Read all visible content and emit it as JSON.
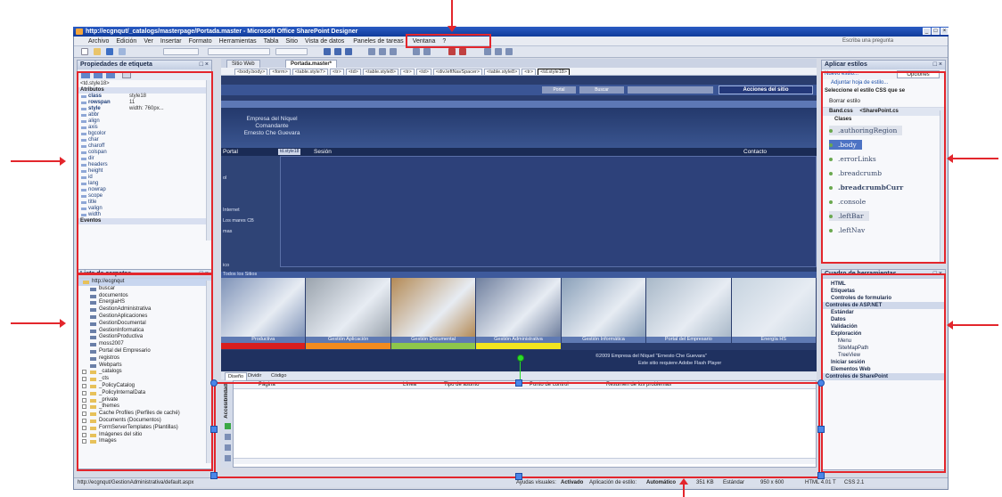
{
  "window": {
    "title": "http://ecgnqut/_catalogs/masterpage/Portada.master - Microsoft Office SharePoint Designer",
    "buttons": [
      "_",
      "□",
      "×"
    ]
  },
  "menu": {
    "items": [
      "Archivo",
      "Edición",
      "Ver",
      "Insertar",
      "Formato",
      "Herramientas",
      "Tabla",
      "Sitio",
      "Vista de datos",
      "Paneles de tareas",
      "Ventana",
      "?"
    ],
    "help_placeholder": "Escriba una pregunta"
  },
  "tag_properties": {
    "title": "Propiedades de etiqueta",
    "selected_tag": "<td.style18>",
    "sections": {
      "attributes": "Atributos",
      "events": "Eventos"
    },
    "attributes": [
      {
        "name": "class",
        "value": "style18"
      },
      {
        "name": "rowspan",
        "value": "11"
      },
      {
        "name": "style",
        "value": "width: 760px..."
      },
      {
        "name": "abbr",
        "value": ""
      },
      {
        "name": "align",
        "value": ""
      },
      {
        "name": "axis",
        "value": ""
      },
      {
        "name": "bgcolor",
        "value": ""
      },
      {
        "name": "char",
        "value": ""
      },
      {
        "name": "charoff",
        "value": ""
      },
      {
        "name": "colspan",
        "value": ""
      },
      {
        "name": "dir",
        "value": ""
      },
      {
        "name": "headers",
        "value": ""
      },
      {
        "name": "height",
        "value": ""
      },
      {
        "name": "id",
        "value": ""
      },
      {
        "name": "lang",
        "value": ""
      },
      {
        "name": "nowrap",
        "value": ""
      },
      {
        "name": "scope",
        "value": ""
      },
      {
        "name": "title",
        "value": ""
      },
      {
        "name": "valign",
        "value": ""
      },
      {
        "name": "width",
        "value": ""
      }
    ]
  },
  "folder_list": {
    "title": "Lista de carpetas",
    "root": "http://ecgnqut",
    "items": [
      {
        "label": "buscar",
        "kind": "site"
      },
      {
        "label": "documentos",
        "kind": "site"
      },
      {
        "label": "EnergiaHS",
        "kind": "site"
      },
      {
        "label": "GestionAdministrativa",
        "kind": "site"
      },
      {
        "label": "GestionAplicaciones",
        "kind": "site"
      },
      {
        "label": "GestionDocumental",
        "kind": "site"
      },
      {
        "label": "GestionInformatica",
        "kind": "site"
      },
      {
        "label": "GestionProductiva",
        "kind": "site"
      },
      {
        "label": "moss2007",
        "kind": "site"
      },
      {
        "label": "Portal del Empresario",
        "kind": "site"
      },
      {
        "label": "registros",
        "kind": "site"
      },
      {
        "label": "Webparts",
        "kind": "site"
      },
      {
        "label": "_catalogs",
        "kind": "folder"
      },
      {
        "label": "_cts",
        "kind": "folder"
      },
      {
        "label": "_PolicyCatalog",
        "kind": "folder"
      },
      {
        "label": "_PolicyInternalData",
        "kind": "folder"
      },
      {
        "label": "_private",
        "kind": "folder"
      },
      {
        "label": "_themes",
        "kind": "folder"
      },
      {
        "label": "Cache Profiles (Perfiles de caché)",
        "kind": "folder"
      },
      {
        "label": "Documents (Documentos)",
        "kind": "folder"
      },
      {
        "label": "FormServerTemplates (Plantillas)",
        "kind": "folder"
      },
      {
        "label": "Imágenes del sitio",
        "kind": "folder"
      },
      {
        "label": "Images",
        "kind": "folder"
      }
    ]
  },
  "document": {
    "tabs": [
      "Sitio Web",
      "Portada.master*"
    ],
    "tag_path": [
      "<body.body>",
      "<form>",
      "<table.style7>",
      "<tr>",
      "<td>",
      "<table.style8>",
      "<tr>",
      "<td>",
      "<div.leftNavSpacer>",
      "<table.style8>",
      "<tr>",
      "<td.style18>"
    ],
    "site": {
      "top_buttons": [
        "Portal",
        "Buscar",
        "Acciones del sitio"
      ],
      "org_line1": "Empresa del Níquel",
      "org_line2": "Comandante",
      "org_line3": "Ernesto Che Guevara",
      "nav_items": [
        "Portal",
        "td.style18",
        "Sesión",
        "Contacto"
      ],
      "left_nav": [
        "",
        "ol",
        "",
        "Internet",
        "Los mares CB",
        "mas",
        "",
        "ico"
      ],
      "section_heading": "Todos los Sitios",
      "photo_labels": [
        "Productiva",
        "Gestión Aplicación",
        "Gestión Documental",
        "Gestión Administrativa",
        "Gestión Informática",
        "Portal del Empresario",
        "Energía HS"
      ],
      "photo_bar_colors": [
        "#d81e1e",
        "#f28b1f",
        "#8ec64b",
        "#f2e51f",
        "#2a3d6e",
        "#2a3d6e",
        "#2a3d6e"
      ],
      "footer_line1": "©2009 Empresa del Níquel \"Ernesto Che Guevara\"",
      "footer_line2": "Este sitio requiere Adobe Flash Player"
    },
    "view_tabs": [
      "Diseño",
      "Dividir",
      "Código"
    ]
  },
  "accessibility": {
    "side_label": "Accesibilidad",
    "columns": [
      "Página",
      "Línea",
      "Tipo de asunto",
      "Punto de control",
      "Resumen de los problemas"
    ]
  },
  "apply_styles": {
    "title": "Aplicar estilos",
    "new_style": "Nuevo estilo...",
    "options": "Opciones",
    "attach": "Adjuntar hoja de estilo...",
    "select_label": "Seleccione el estilo CSS que se",
    "clear": "Borrar estilo",
    "sheet": "Band.css",
    "sheet_path": "<SharePoint.cs",
    "classes_label": "Clases",
    "classes": [
      ".authoringRegion",
      ".body",
      ".errorLinks",
      ".breadcrumb",
      ".breadcrumbCurr",
      ".console",
      ".leftBar",
      ".leftNav"
    ]
  },
  "toolbox": {
    "title": "Cuadro de herramientas",
    "items": [
      {
        "label": "HTML",
        "style": "bold"
      },
      {
        "label": "Etiquetas",
        "style": "bold"
      },
      {
        "label": "Controles de formulario",
        "style": "bold"
      },
      {
        "label": "Controles de ASP.NET",
        "style": "band"
      },
      {
        "label": "Estándar",
        "style": "bold"
      },
      {
        "label": "Datos",
        "style": "bold"
      },
      {
        "label": "Validación",
        "style": "bold"
      },
      {
        "label": "Exploración",
        "style": "bold"
      },
      {
        "label": "Menu",
        "style": "normal"
      },
      {
        "label": "SiteMapPath",
        "style": "normal"
      },
      {
        "label": "TreeView",
        "style": "normal"
      },
      {
        "label": "Iniciar sesión",
        "style": "bold"
      },
      {
        "label": "Elementos Web",
        "style": "bold"
      },
      {
        "label": "Controles de SharePoint",
        "style": "band"
      }
    ]
  },
  "statusbar": {
    "url": "http://ecgnqut/GestionAdministrativa/default.aspx",
    "visual_aids": "Ayudas visuales:",
    "visual_aids_value": "Activado",
    "style_app": "Aplicación de estilo:",
    "style_app_value": "Automático",
    "size": "351 KB",
    "mode": "Estándar",
    "dimensions": "950 x 600",
    "doctype": "HTML 4.01 T",
    "css": "CSS 2.1"
  },
  "colors": {
    "annotation": "#e3262c",
    "site_background": "#2a3d6e",
    "title_bar": "#0f3b9a"
  }
}
